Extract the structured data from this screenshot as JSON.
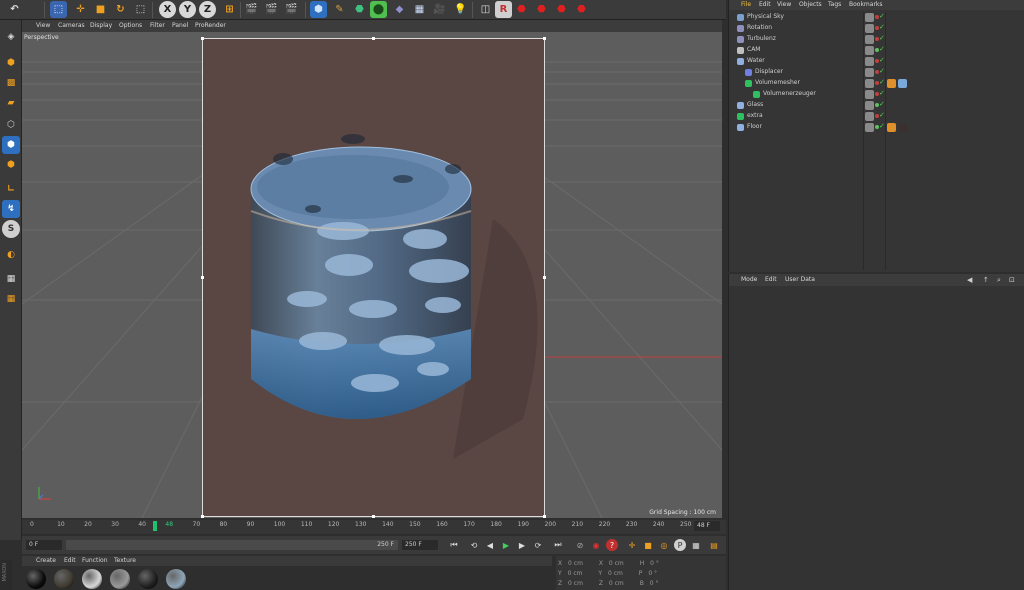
{
  "viewport": {
    "menu": [
      "View",
      "Cameras",
      "Display",
      "Options",
      "Filter",
      "Panel",
      "ProRender"
    ],
    "camera_label": "Perspective",
    "grid_spacing": "Grid Spacing : 100 cm"
  },
  "timeline": {
    "ticks": [
      "0",
      "10",
      "20",
      "30",
      "40",
      "48",
      "70",
      "80",
      "90",
      "100",
      "110",
      "120",
      "130",
      "140",
      "150",
      "160",
      "170",
      "180",
      "190",
      "200",
      "210",
      "220",
      "230",
      "240",
      "250"
    ],
    "current_frame": 48,
    "fps_field": "48 F"
  },
  "transport": {
    "start_field": "0 F",
    "end_field": "250 F",
    "range_label": "250 F"
  },
  "materials": {
    "menu": [
      "Create",
      "Edit",
      "Function",
      "Texture"
    ],
    "balls": [
      "#0b0b0b",
      "#3e3a30",
      "#d8d8d8",
      "#9a9a9a",
      "#1e1e1e",
      "#8fa6b8"
    ]
  },
  "coords": {
    "rows": [
      {
        "a": "X",
        "v1": "0 cm",
        "b": "X",
        "v2": "0 cm",
        "c": "H",
        "v3": "0 °"
      },
      {
        "a": "Y",
        "v1": "0 cm",
        "b": "Y",
        "v2": "0 cm",
        "c": "P",
        "v3": "0 °"
      },
      {
        "a": "Z",
        "v1": "0 cm",
        "b": "Z",
        "v2": "0 cm",
        "c": "B",
        "v3": "0 °"
      }
    ]
  },
  "object_manager": {
    "menu": [
      "File",
      "Edit",
      "View",
      "Objects",
      "Tags",
      "Bookmarks"
    ],
    "objects": [
      {
        "name": "Physical Sky",
        "depth": 0,
        "color": "#7aa0d0",
        "tags": []
      },
      {
        "name": "Rotation",
        "depth": 0,
        "color": "#9090c0",
        "tags": []
      },
      {
        "name": "Turbulenz",
        "depth": 0,
        "color": "#9090c0",
        "tags": []
      },
      {
        "name": "CAM",
        "depth": 0,
        "color": "#c0c0c0",
        "tags": []
      },
      {
        "name": "Water",
        "depth": 0,
        "color": "#8fb0e0",
        "tags": []
      },
      {
        "name": "Displacer",
        "depth": 1,
        "color": "#7080e0",
        "tags": []
      },
      {
        "name": "Volumemesher",
        "depth": 1,
        "color": "#30c060",
        "tags": [
          "orange",
          "blue"
        ]
      },
      {
        "name": "Volumenerzeuger",
        "depth": 2,
        "color": "#30c060",
        "tags": []
      },
      {
        "name": "Glass",
        "depth": 0,
        "color": "#8fb0e0",
        "tags": []
      },
      {
        "name": "extra",
        "depth": 0,
        "color": "#30c060",
        "tags": []
      },
      {
        "name": "Floor",
        "depth": 0,
        "color": "#8fb0e0",
        "tags": [
          "orange",
          "dark"
        ]
      }
    ]
  },
  "attribute_manager": {
    "menu": [
      "Mode",
      "Edit",
      "User Data"
    ]
  },
  "brand_label": "MAXON"
}
